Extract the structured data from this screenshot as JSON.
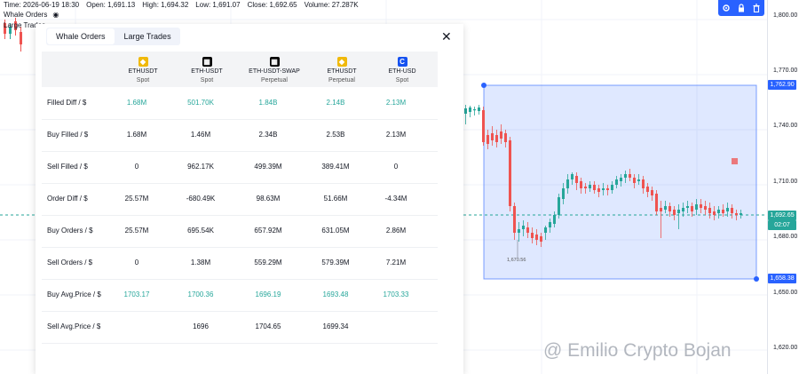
{
  "topbar": {
    "time": "Time: 2026-06-19 18:30",
    "open": "Open: 1,691.13",
    "high": "High: 1,694.32",
    "low": "Low: 1,691.07",
    "close": "Close: 1,692.65",
    "volume": "Volume: 27.287K"
  },
  "legend": {
    "whale_orders": "Whale Orders",
    "large_trades": "Large Trades"
  },
  "toolbar": {
    "icons": [
      "settings-icon",
      "lock-icon",
      "trash-icon"
    ],
    "color": "#2962ff"
  },
  "price_axis": {
    "labels": [
      "1,800.00",
      "1,770.00",
      "1,740.00",
      "1,710.00",
      "1,680.00",
      "1,650.00",
      "1,620.00"
    ],
    "badge_high": "1,762.90",
    "badge_current": "1,692.65",
    "badge_countdown": "02:07",
    "badge_low": "1,658.38"
  },
  "chart": {
    "low_annotation": "1,670.56",
    "selection_color": "#2962ff"
  },
  "panel": {
    "tabs": [
      "Whale Orders",
      "Large Trades"
    ],
    "active_tab": "Whale Orders",
    "close_label": "✕",
    "columns": [
      {
        "symbol": "ETHUSDT",
        "market": "Spot",
        "exchange_icon": "binance-icon"
      },
      {
        "symbol": "ETH-USDT",
        "market": "Spot",
        "exchange_icon": "okx-icon"
      },
      {
        "symbol": "ETH-USDT-SWAP",
        "market": "Perpetual",
        "exchange_icon": "okx-icon"
      },
      {
        "symbol": "ETHUSDT",
        "market": "Perpetual",
        "exchange_icon": "binance-icon"
      },
      {
        "symbol": "ETH-USD",
        "market": "Spot",
        "exchange_icon": "coinbase-icon"
      }
    ],
    "rows": [
      {
        "label": "Filled Diff / $",
        "values": [
          "1.68M",
          "501.70K",
          "1.84B",
          "2.14B",
          "2.13M"
        ],
        "green": true
      },
      {
        "label": "Buy Filled / $",
        "values": [
          "1.68M",
          "1.46M",
          "2.34B",
          "2.53B",
          "2.13M"
        ],
        "green": false
      },
      {
        "label": "Sell Filled / $",
        "values": [
          "0",
          "962.17K",
          "499.39M",
          "389.41M",
          "0"
        ],
        "green": false
      },
      {
        "label": "Order Diff / $",
        "values": [
          "25.57M",
          "-680.49K",
          "98.63M",
          "51.66M",
          "-4.34M"
        ],
        "green": false
      },
      {
        "label": "Buy Orders / $",
        "values": [
          "25.57M",
          "695.54K",
          "657.92M",
          "631.05M",
          "2.86M"
        ],
        "green": false
      },
      {
        "label": "Sell Orders / $",
        "values": [
          "0",
          "1.38M",
          "559.29M",
          "579.39M",
          "7.21M"
        ],
        "green": false
      },
      {
        "label": "Buy Avg.Price / $",
        "values": [
          "1703.17",
          "1700.36",
          "1696.19",
          "1693.48",
          "1703.33"
        ],
        "green": true
      },
      {
        "label": "Sell Avg.Price / $",
        "values": [
          "",
          "1696",
          "1704.65",
          "1699.34",
          ""
        ],
        "green": false
      }
    ]
  },
  "watermark": "@ Emilio Crypto Bojan",
  "colors": {
    "up": "#26a69a",
    "down": "#ef5350",
    "binance": "#f0b90b",
    "okx": "#000000",
    "coinbase": "#1652f0"
  }
}
